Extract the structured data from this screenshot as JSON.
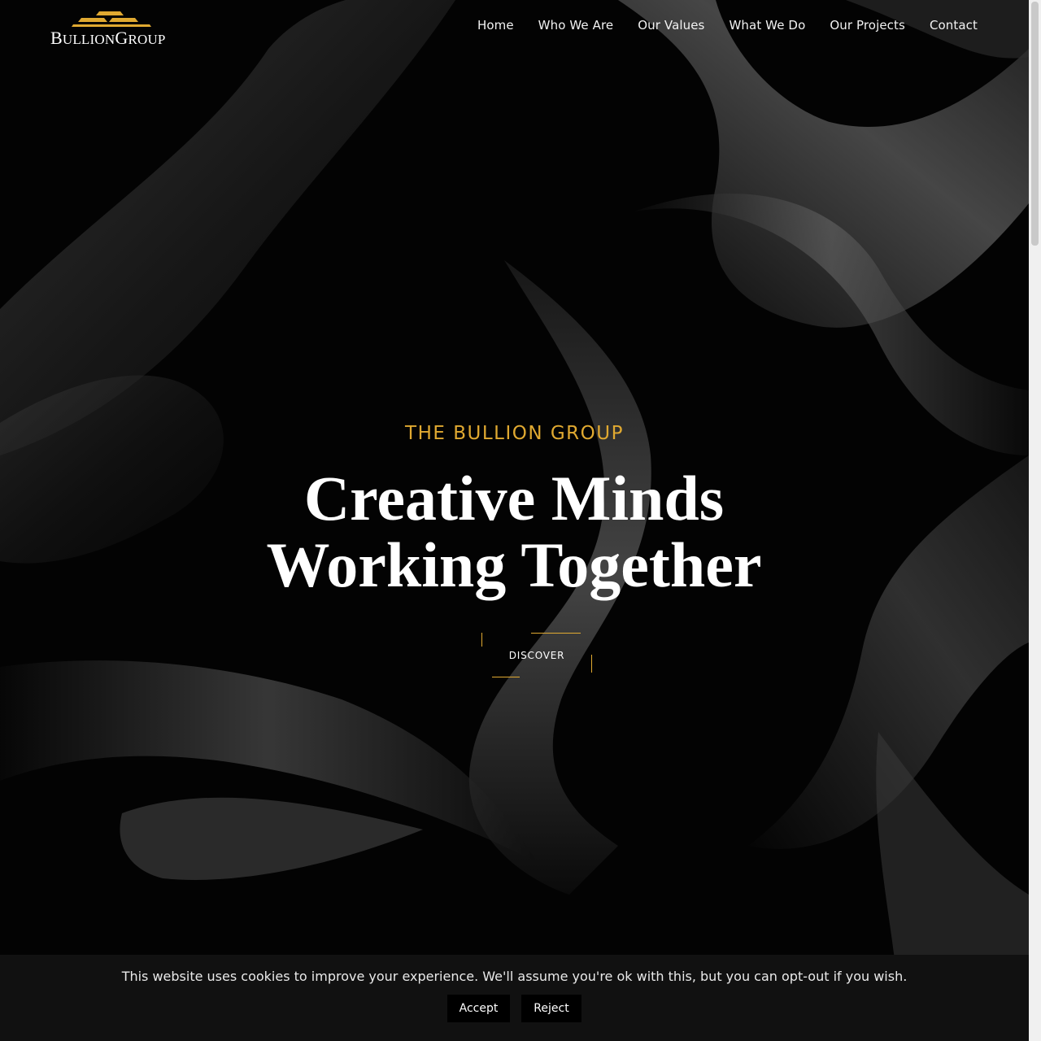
{
  "brand": {
    "logo_text_1": "B",
    "logo_text_2": "ULLION",
    "logo_text_3": "G",
    "logo_text_4": "ROUP",
    "gold_color": "#e0a931"
  },
  "nav": {
    "items": [
      {
        "label": "Home"
      },
      {
        "label": "Who We Are"
      },
      {
        "label": "Our Values"
      },
      {
        "label": "What We Do"
      },
      {
        "label": "Our Projects"
      },
      {
        "label": "Contact"
      }
    ]
  },
  "hero": {
    "eyebrow": "THE BULLION GROUP",
    "title_line_1": "Creative Minds",
    "title_line_2": "Working Together",
    "cta_label": "DISCOVER"
  },
  "cookie": {
    "message": "This website uses cookies to improve your experience. We'll assume you're ok with this, but you can opt-out if you wish.",
    "accept_label": "Accept",
    "reject_label": "Reject"
  }
}
